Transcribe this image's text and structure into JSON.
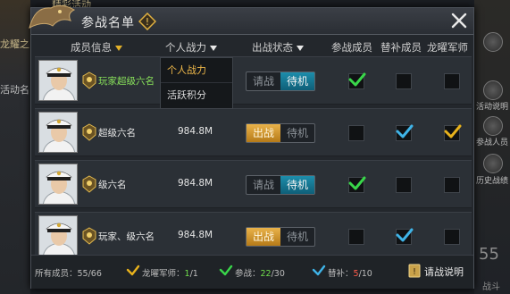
{
  "background": {
    "top_tab_text": "精彩活动",
    "left_label_1": "龙耀之",
    "left_label_2": "活动名",
    "right_labels": [
      "活动说明",
      "参战人员",
      "历史战绩"
    ],
    "right_number": "55",
    "right_bottom": "战斗"
  },
  "dialog": {
    "title": "参战名单",
    "columns": {
      "member_info": "成员信息",
      "power": "个人战力",
      "status": "出战状态",
      "participating": "参战成员",
      "substitute": "替补成员",
      "strategist": "龙曜军师"
    },
    "sort_menu": [
      "个人战力",
      "活跃积分"
    ],
    "rows": [
      {
        "name": "玩家超级六名",
        "name_color": "green",
        "power": "",
        "status_left": "请战",
        "status_right": "待机",
        "active": "right",
        "participating": true,
        "substitute": false,
        "strategist": false
      },
      {
        "name": "超级六名",
        "name_color": "white",
        "power": "984.8M",
        "status_left": "出战",
        "status_right": "待机",
        "active": "left",
        "participating": false,
        "substitute": true,
        "strategist": true
      },
      {
        "name": "级六名",
        "name_color": "white",
        "power": "984.8M",
        "status_left": "请战",
        "status_right": "待机",
        "active": "right",
        "participating": true,
        "substitute": false,
        "strategist": false
      },
      {
        "name": "玩家、级六名",
        "name_color": "white",
        "power": "984.8M",
        "status_left": "出战",
        "status_right": "待机",
        "active": "left",
        "participating": false,
        "substitute": true,
        "strategist": false
      }
    ],
    "footer": {
      "all_members_label": "所有成员：",
      "all_members_value": "55/66",
      "strategist_label": "龙曜军师：",
      "strategist_current": "1",
      "strategist_total": "/1",
      "participating_label": "参战：",
      "participating_current": "22",
      "participating_total": "/30",
      "substitute_label": "替补：",
      "substitute_current": "5",
      "substitute_total": "/10",
      "help_label": "请战说明"
    }
  },
  "colors": {
    "check_green": "#39d64a",
    "check_blue": "#3fb4e8",
    "check_gold": "#e8b21c"
  }
}
